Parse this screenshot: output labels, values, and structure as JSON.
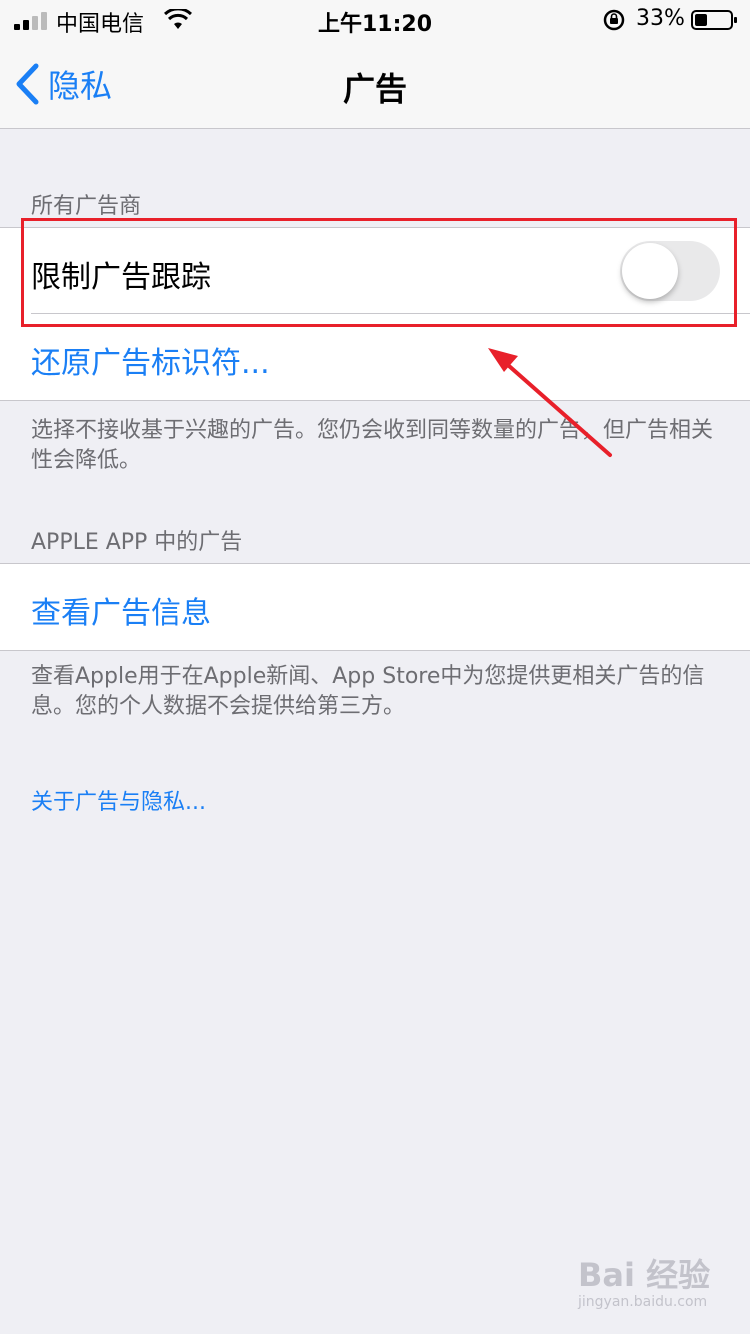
{
  "status_bar": {
    "carrier": "中国电信",
    "time": "上午11:20",
    "battery_percent": "33%",
    "icons": [
      "signal-bars-icon",
      "wifi-icon",
      "rotation-lock-icon",
      "battery-icon"
    ]
  },
  "nav": {
    "back_label": "隐私",
    "title": "广告",
    "back_icon": "chevron-left-icon"
  },
  "section_all_advertisers": {
    "header": "所有广告商",
    "limit_tracking_label": "限制广告跟踪",
    "limit_tracking_on": false,
    "reset_identifier_label": "还原广告标识符...",
    "footer": "选择不接收基于兴趣的广告。您仍会收到同等数量的广告，但广告相关性会降低。"
  },
  "section_apple_ads": {
    "header": "APPLE APP 中的广告",
    "view_info_label": "查看广告信息",
    "footer": "查看Apple用于在Apple新闻、App Store中为您提供更相关广告的信息。您的个人数据不会提供给第三方。"
  },
  "about_link": "关于广告与隐私...",
  "annotation": {
    "color": "#e8202a"
  },
  "watermark": {
    "main": "Bai 经验",
    "sub": "jingyan.baidu.com"
  },
  "colors": {
    "accent": "#1a7ff5",
    "background": "#efeff4",
    "toggle_off": "#e9e9ea"
  }
}
